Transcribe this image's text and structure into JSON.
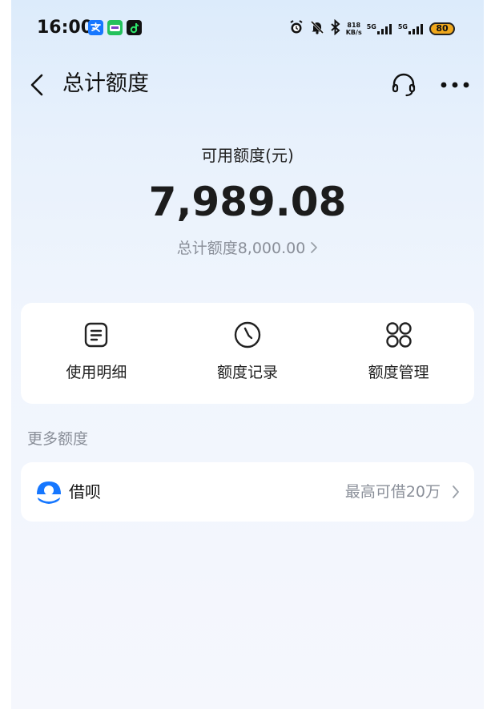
{
  "status_bar": {
    "time": "16:00",
    "net_speed_value": "818",
    "net_speed_unit": "KB/s",
    "signal_label_1": "5G",
    "signal_label_2": "5G",
    "battery": "80",
    "app_icons": [
      "alipay-icon",
      "wechat-pay-icon",
      "douyin-icon"
    ],
    "status_icons": [
      "alarm-icon",
      "mute-icon",
      "bluetooth-icon"
    ]
  },
  "nav": {
    "title": "总计额度",
    "back_icon": "chevron-left-icon",
    "service_icon": "headset-icon",
    "more_icon": "more-icon"
  },
  "summary": {
    "available_label": "可用额度(元)",
    "available_amount": "7,989.08",
    "total_link": "总计额度8,000.00"
  },
  "actions": [
    {
      "label": "使用明细",
      "icon": "list-detail-icon"
    },
    {
      "label": "额度记录",
      "icon": "clock-icon"
    },
    {
      "label": "额度管理",
      "icon": "grid-apps-icon"
    }
  ],
  "more_credit": {
    "section_title": "更多额度",
    "items": [
      {
        "name": "借呗",
        "desc": "最高可借20万",
        "icon": "jiebei-logo-icon"
      }
    ]
  },
  "colors": {
    "accent": "#1677ff",
    "text_primary": "#111111",
    "text_secondary": "#8a8f99",
    "battery": "#f0a81c",
    "background_top": "#dcebfb"
  }
}
